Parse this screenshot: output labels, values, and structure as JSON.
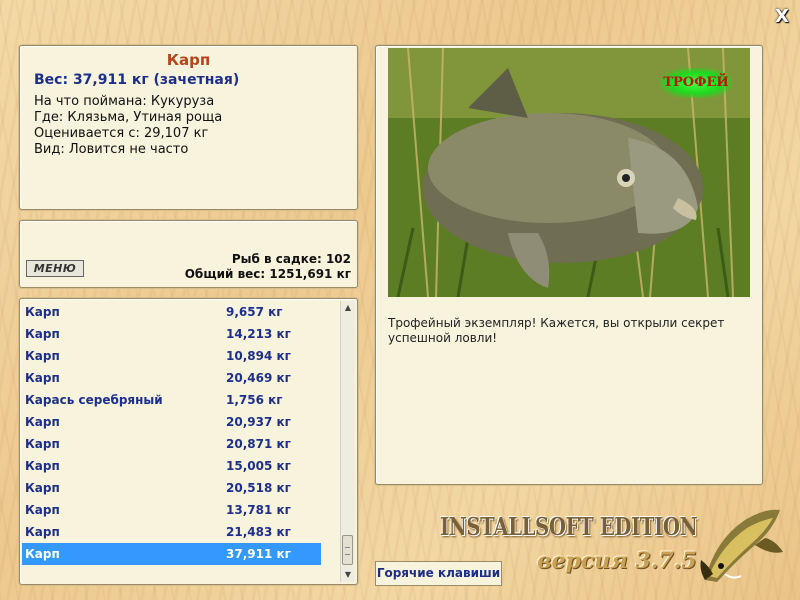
{
  "window": {
    "close_label": "X"
  },
  "info": {
    "title": "Карп",
    "weight": "Вес: 37,911 кг (зачетная)",
    "bait": "На что поймана: Кукуруза",
    "place": "Где: Клязьма, Утиная роща",
    "rated": "Оценивается с: 29,107 кг",
    "kind": "Вид: Ловится не часто"
  },
  "summary": {
    "menu_label": "МЕНЮ",
    "fish_count": "Рыб в садке: 102",
    "total_weight": "Общий вес: 1251,691 кг"
  },
  "catch_list": [
    {
      "name": "Карп",
      "weight": "9,657 кг"
    },
    {
      "name": "Карп",
      "weight": "14,213 кг"
    },
    {
      "name": "Карп",
      "weight": "10,894 кг"
    },
    {
      "name": "Карп",
      "weight": "20,469 кг"
    },
    {
      "name": "Карась серебряный",
      "weight": "1,756 кг"
    },
    {
      "name": "Карп",
      "weight": "20,937 кг"
    },
    {
      "name": "Карп",
      "weight": "20,871 кг"
    },
    {
      "name": "Карп",
      "weight": "15,005 кг"
    },
    {
      "name": "Карп",
      "weight": "20,518 кг"
    },
    {
      "name": "Карп",
      "weight": "13,781 кг"
    },
    {
      "name": "Карп",
      "weight": "21,483 кг"
    },
    {
      "name": "Карп",
      "weight": "37,911 кг",
      "selected": true
    }
  ],
  "photo": {
    "badge": "ТРОФЕЙ",
    "description": "Трофейный экземпляр! Кажется, вы открыли секрет успешной ловли!"
  },
  "footer": {
    "hotkeys_label": "Горячие клавиши",
    "edition": "INSTALLSOFT EDITION",
    "version": "версия 3.7.5"
  },
  "colors": {
    "accent": "#3399ff",
    "title": "#b5451b",
    "text_blue": "#1d2f8a",
    "trophy_glow": "#22e622"
  },
  "icons": {
    "close": "close-icon",
    "scroll_up": "chevron-up-icon",
    "scroll_down": "chevron-down-icon",
    "logo": "pike-fish-icon"
  }
}
